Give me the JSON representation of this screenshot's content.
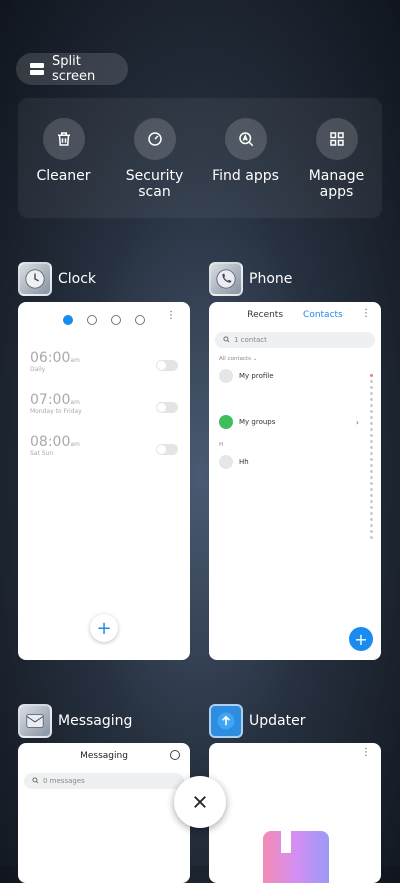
{
  "split_screen": {
    "label": "Split screen"
  },
  "tools": [
    {
      "label": "Cleaner",
      "icon": "trash-icon"
    },
    {
      "label": "Security scan",
      "icon": "security-scan-icon"
    },
    {
      "label": "Find apps",
      "icon": "find-apps-icon"
    },
    {
      "label": "Manage apps",
      "icon": "grid-icon"
    }
  ],
  "apps": {
    "clock": {
      "name": "Clock",
      "alarms": [
        {
          "time": "06:00",
          "ampm": "am",
          "repeat": "Daily"
        },
        {
          "time": "07:00",
          "ampm": "am",
          "repeat": "Monday to Friday"
        },
        {
          "time": "08:00",
          "ampm": "am",
          "repeat": "Sat Sun"
        }
      ],
      "add": "+"
    },
    "phone": {
      "name": "Phone",
      "tabs": [
        "Recents",
        "Contacts"
      ],
      "search_placeholder": "1 contact",
      "all_contacts": "All contacts",
      "my_profile": "My profile",
      "my_groups": "My groups",
      "section_h": "H",
      "contact_name": "Hh",
      "add": "+"
    },
    "messaging": {
      "name": "Messaging",
      "title": "Messaging",
      "search_placeholder": "0 messages"
    },
    "updater": {
      "name": "Updater"
    }
  },
  "colors": {
    "accent": "#1a8cf0"
  }
}
